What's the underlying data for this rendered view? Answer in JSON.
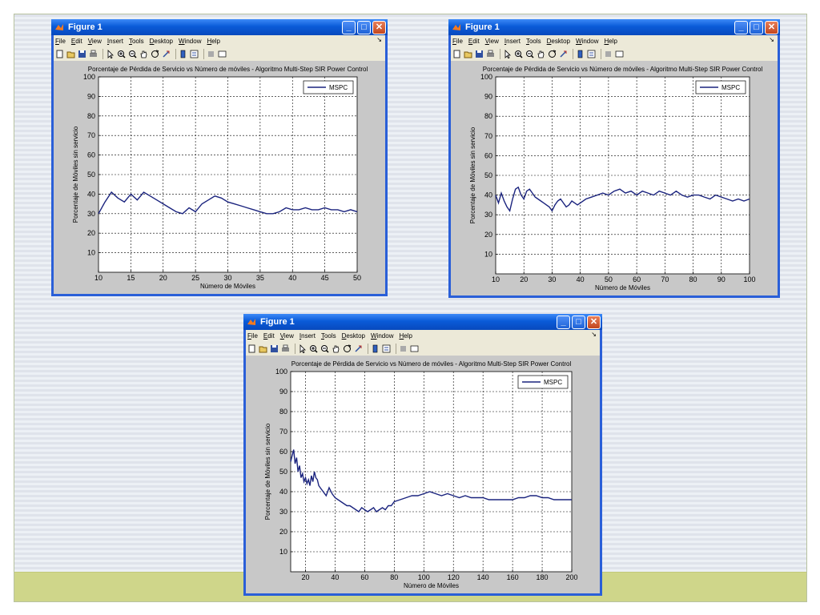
{
  "window": {
    "title": "Figure 1",
    "menu": [
      "File",
      "Edit",
      "View",
      "Insert",
      "Tools",
      "Desktop",
      "Window",
      "Help"
    ],
    "dock_arrow": "↘",
    "toolbar_icons": [
      "new-figure-icon",
      "open-file-icon",
      "save-icon",
      "print-icon",
      "sep",
      "pointer-icon",
      "zoom-in-icon",
      "zoom-out-icon",
      "pan-hand-icon",
      "rotate-3d-icon",
      "data-cursor-icon",
      "sep",
      "colorbar-icon",
      "legend-icon",
      "sep",
      "hide-tools-icon",
      "show-tools-icon"
    ]
  },
  "colors": {
    "line": "#1a237e",
    "title_bar": "#0a5bd8",
    "axes_bg": "#ffffff",
    "figure_bg": "#c8c8c8"
  },
  "chart_data": [
    {
      "type": "line",
      "title": "Porcentaje de Pérdida de Servicio vs Número de móviles - Algoritmo Multi-Step SIR Power Control",
      "xlabel": "Número de Móviles",
      "ylabel": "Porcentaje de Móviles sin servicio",
      "xlim": [
        10,
        50
      ],
      "ylim": [
        0,
        100
      ],
      "xticks": [
        10,
        15,
        20,
        25,
        30,
        35,
        40,
        45,
        50
      ],
      "yticks": [
        10,
        20,
        30,
        40,
        50,
        60,
        70,
        80,
        90,
        100
      ],
      "grid": true,
      "legend_position": "top-right",
      "series": [
        {
          "name": "MSPC",
          "x": [
            10,
            11,
            12,
            13,
            14,
            15,
            16,
            17,
            18,
            19,
            20,
            21,
            22,
            23,
            24,
            25,
            26,
            27,
            28,
            29,
            30,
            31,
            32,
            33,
            34,
            35,
            36,
            37,
            38,
            39,
            40,
            41,
            42,
            43,
            44,
            45,
            46,
            47,
            48,
            49,
            50
          ],
          "y": [
            30,
            36,
            41,
            38,
            36,
            40,
            37,
            41,
            39,
            37,
            35,
            33,
            31,
            30,
            33,
            31,
            35,
            37,
            39,
            38,
            36,
            35,
            34,
            33,
            32,
            31,
            30,
            30,
            31,
            33,
            32,
            32,
            33,
            32,
            32,
            33,
            32,
            32,
            31,
            32,
            31
          ]
        }
      ]
    },
    {
      "type": "line",
      "title": "Porcentaje de Pérdida de Servicio vs Número de móviles - Algoritmo Multi-Step SIR Power Control",
      "xlabel": "Número de Móviles",
      "ylabel": "Porcentaje de Móviles sin servicio",
      "xlim": [
        10,
        100
      ],
      "ylim": [
        0,
        100
      ],
      "xticks": [
        10,
        20,
        30,
        40,
        50,
        60,
        70,
        80,
        90,
        100
      ],
      "yticks": [
        10,
        20,
        30,
        40,
        50,
        60,
        70,
        80,
        90,
        100
      ],
      "grid": true,
      "legend_position": "top-right",
      "series": [
        {
          "name": "MSPC",
          "x": [
            10,
            11,
            12,
            13,
            14,
            15,
            16,
            17,
            18,
            19,
            20,
            21,
            22,
            23,
            24,
            25,
            26,
            27,
            28,
            29,
            30,
            31,
            32,
            33,
            34,
            35,
            36,
            37,
            38,
            39,
            40,
            42,
            44,
            46,
            48,
            50,
            52,
            54,
            56,
            58,
            60,
            62,
            64,
            66,
            68,
            70,
            72,
            74,
            76,
            78,
            80,
            82,
            84,
            86,
            88,
            90,
            92,
            94,
            96,
            98,
            100
          ],
          "y": [
            40,
            36,
            41,
            37,
            34,
            32,
            38,
            43,
            44,
            40,
            38,
            42,
            43,
            41,
            39,
            38,
            37,
            36,
            35,
            34,
            32,
            35,
            37,
            38,
            36,
            34,
            35,
            37,
            36,
            35,
            36,
            38,
            39,
            40,
            41,
            40,
            42,
            43,
            41,
            42,
            40,
            42,
            41,
            40,
            42,
            41,
            40,
            42,
            40,
            39,
            40,
            40,
            39,
            38,
            40,
            39,
            38,
            37,
            38,
            37,
            38
          ]
        }
      ]
    },
    {
      "type": "line",
      "title": "Porcentaje de Pérdida de Servicio vs Número de móviles - Algoritmo Multi-Step SIR Power Control",
      "xlabel": "Número de Móviles",
      "ylabel": "Porcentaje de Móviles sin servicio",
      "xlim": [
        10,
        200
      ],
      "ylim": [
        0,
        100
      ],
      "xticks": [
        20,
        40,
        60,
        80,
        100,
        120,
        140,
        160,
        180,
        200
      ],
      "yticks": [
        10,
        20,
        30,
        40,
        50,
        60,
        70,
        80,
        90,
        100
      ],
      "grid": true,
      "legend_position": "top-right",
      "series": [
        {
          "name": "MSPC",
          "x": [
            10,
            11,
            12,
            13,
            14,
            15,
            16,
            17,
            18,
            19,
            20,
            21,
            22,
            23,
            24,
            25,
            26,
            27,
            28,
            29,
            30,
            32,
            34,
            36,
            38,
            40,
            42,
            44,
            46,
            48,
            50,
            52,
            54,
            56,
            58,
            60,
            62,
            64,
            66,
            68,
            70,
            72,
            74,
            76,
            78,
            80,
            84,
            88,
            92,
            96,
            100,
            104,
            108,
            112,
            116,
            120,
            124,
            128,
            132,
            136,
            140,
            144,
            148,
            152,
            156,
            160,
            164,
            168,
            172,
            176,
            180,
            184,
            188,
            192,
            196,
            200
          ],
          "y": [
            55,
            58,
            61,
            54,
            57,
            50,
            53,
            47,
            49,
            45,
            47,
            44,
            46,
            43,
            48,
            45,
            50,
            47,
            46,
            43,
            42,
            40,
            38,
            42,
            39,
            37,
            36,
            35,
            34,
            33,
            33,
            32,
            31,
            30,
            32,
            31,
            30,
            31,
            32,
            30,
            31,
            32,
            31,
            33,
            33,
            35,
            36,
            37,
            38,
            38,
            39,
            40,
            39,
            38,
            39,
            38,
            37,
            38,
            37,
            37,
            37,
            36,
            36,
            36,
            36,
            36,
            37,
            37,
            38,
            38,
            37,
            37,
            36,
            36,
            36,
            36
          ]
        }
      ]
    }
  ]
}
